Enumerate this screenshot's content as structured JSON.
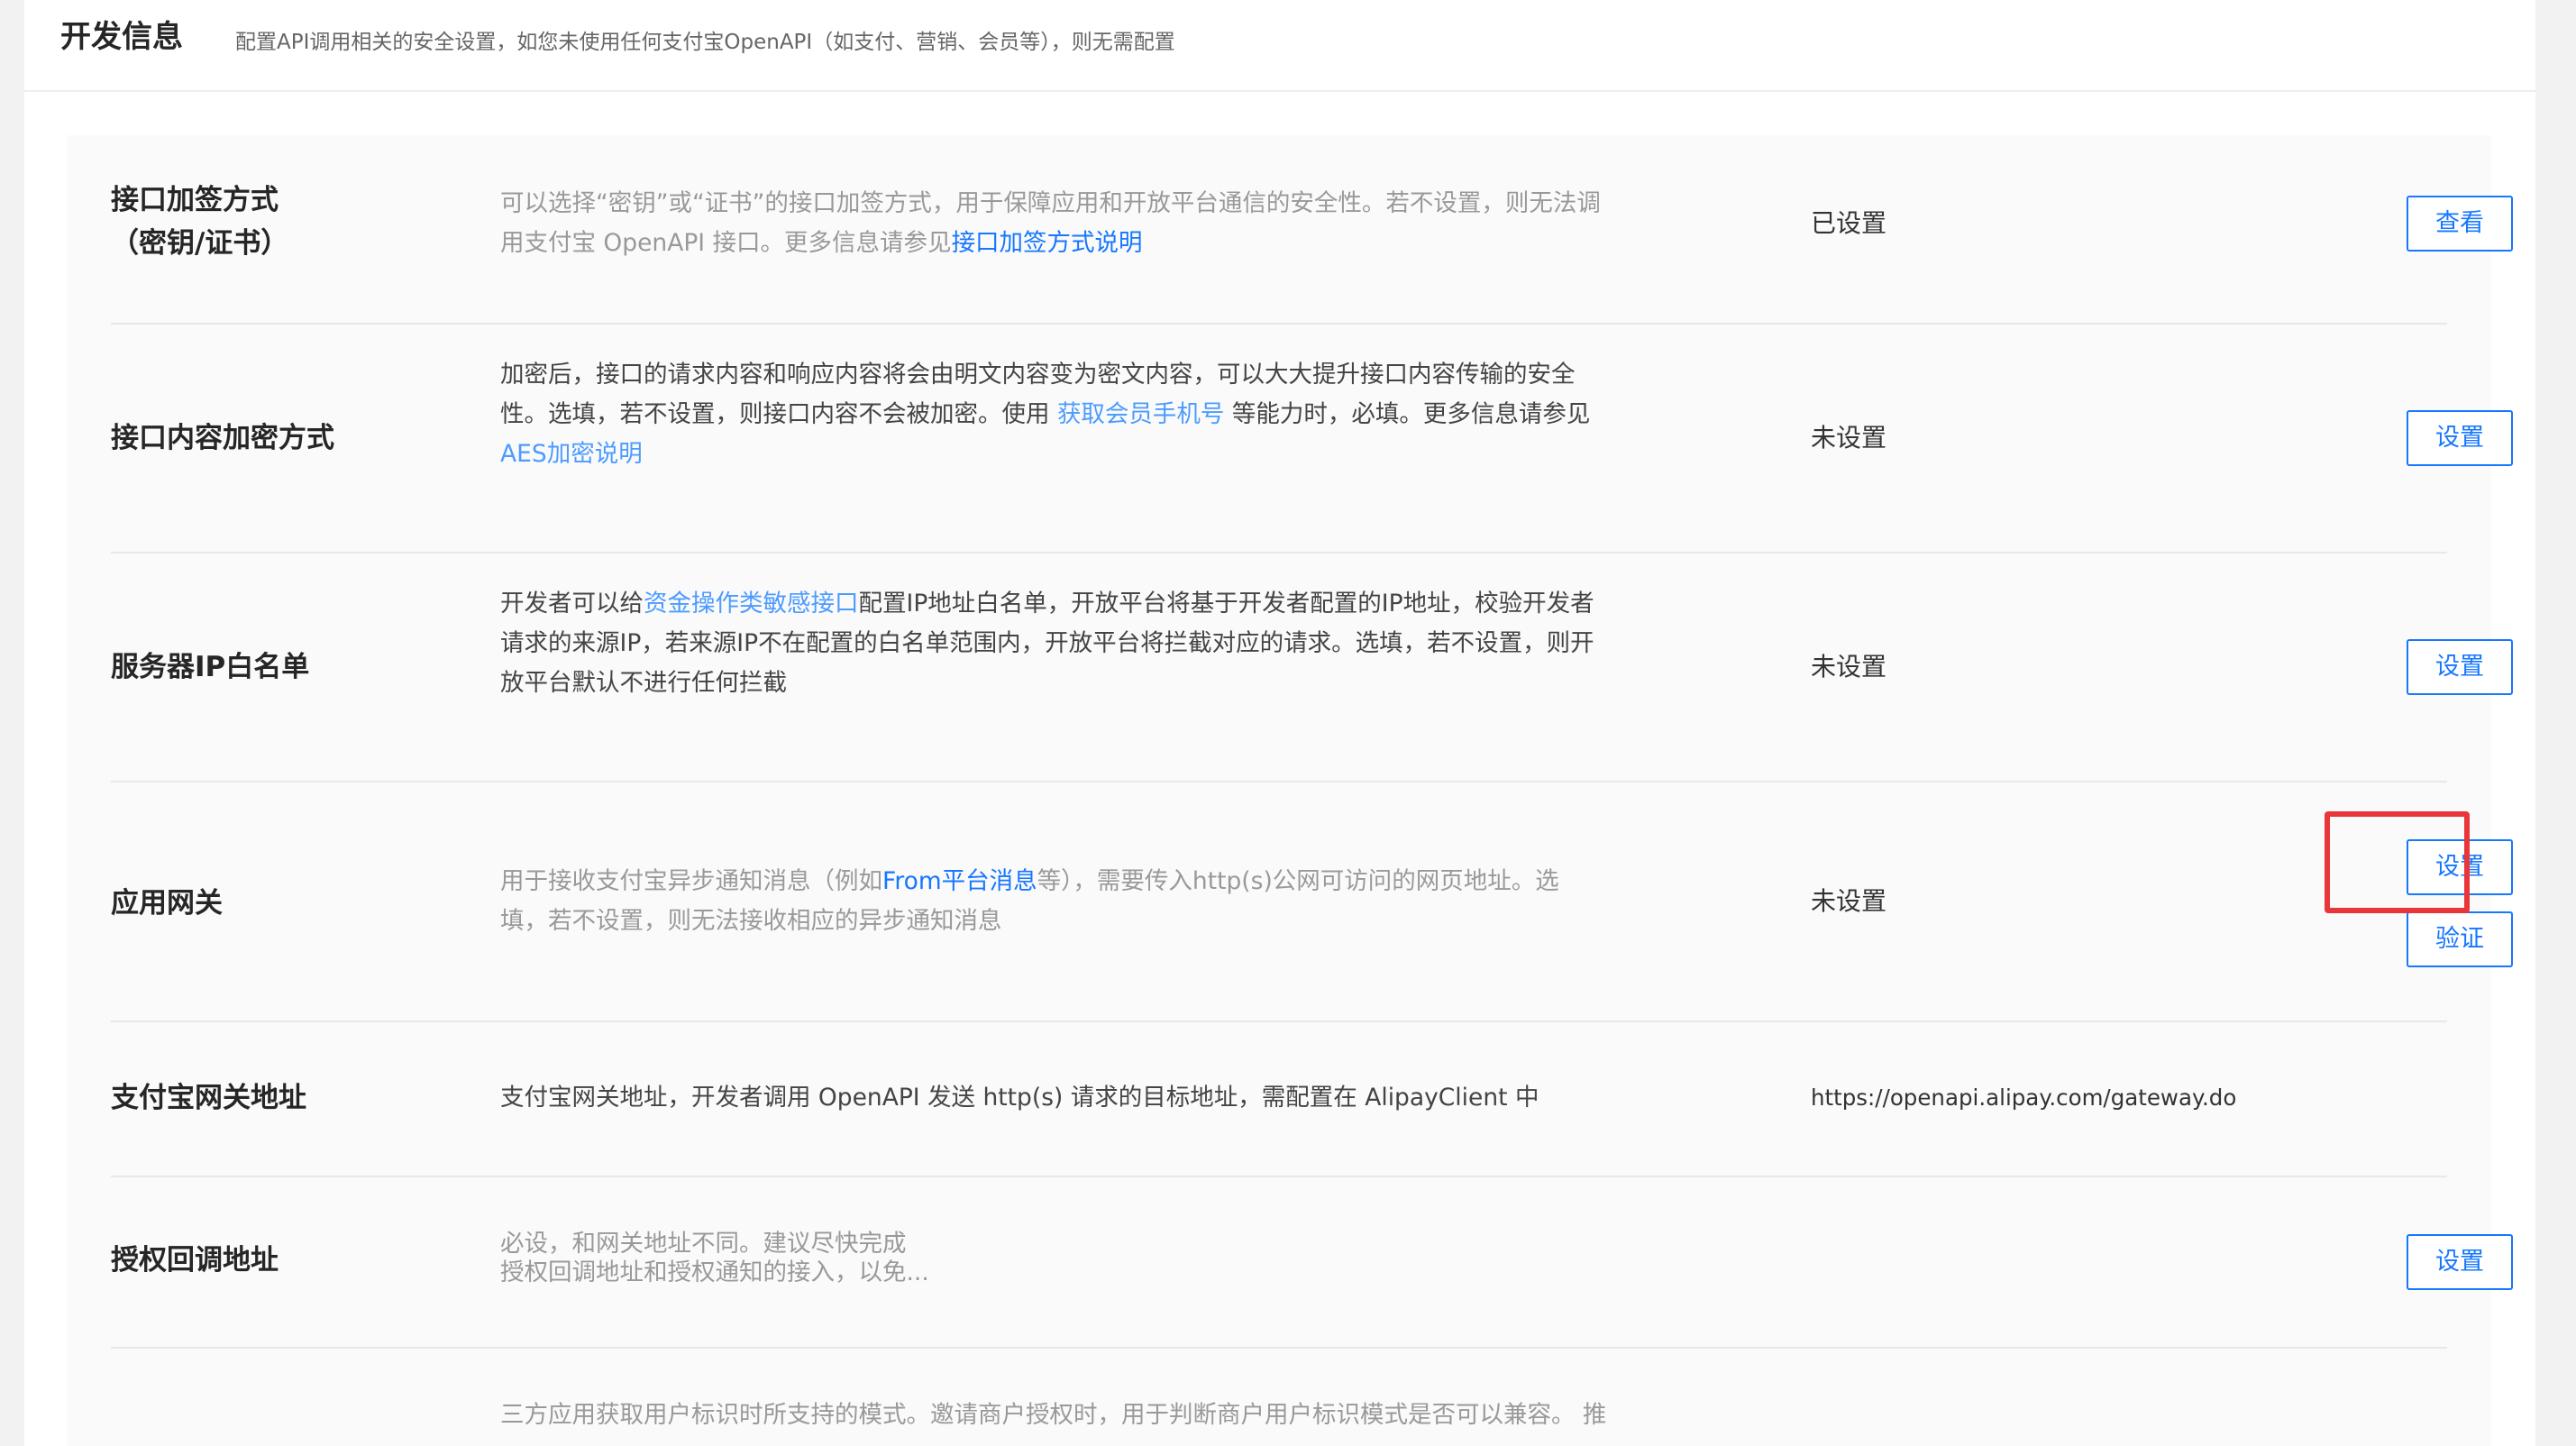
{
  "header": {
    "title": "开发信息",
    "description": "配置API调用相关的安全设置，如您未使用任何支付宝OpenAPI（如支付、营销、会员等），则无需配置"
  },
  "rows": [
    {
      "label_line1": "接口加签方式",
      "label_line2": "（密钥/证书）",
      "desc_line1": "可以选择“密钥”或“证书”的接口加签方式，用于保障应用和开放平台通信的安全性。若不设置，则无法调",
      "desc_line2_text": "用支付宝 OpenAPI 接口。更多信息请参见",
      "desc_link": "接口加签方式说明",
      "status": "已设置",
      "button": "查看"
    },
    {
      "label": "接口内容加密方式",
      "desc_line1": "加密后，接口的请求内容和响应内容将会由明文内容变为密文内容，可以大大提升接口内容传输的安全",
      "desc_line2_text": "性。选填，若不设置，则接口内容不会被加密。使用 ",
      "desc_link1": "获取会员手机号",
      "desc_line2_after": " 等能力时，必填。更多信息请参见",
      "desc_link2": "AES加密说明",
      "status": "未设置",
      "button": "设置"
    },
    {
      "label": "服务器IP白名单",
      "desc_line1_before": "开发者可以给",
      "desc_link": "资金操作类敏感接口",
      "desc_line1_after": "配置IP地址白名单，开放平台将基于开发者配置的IP地址，校验开发者",
      "desc_line2": "请求的来源IP，若来源IP不在配置的白名单范围内，开放平台将拦截对应的请求。选填，若不设置，则开",
      "desc_line3": "放平台默认不进行任何拦截",
      "status": "未设置",
      "button": "设置"
    },
    {
      "label": "应用网关",
      "desc_line1_before": "用于接收支付宝异步通知消息（例如",
      "desc_link": "From平台消息",
      "desc_line1_after": "等），需要传入http(s)公网可访问的网页地址。选",
      "desc_line2": "填，若不设置，则无法接收相应的异步通知消息",
      "status": "未设置",
      "button": "设置",
      "button2": "验证"
    },
    {
      "label": "支付宝网关地址",
      "desc": "支付宝网关地址，开发者调用 OpenAPI 发送 http(s) 请求的目标地址，需配置在 AlipayClient 中",
      "status": "https://openapi.alipay.com/gateway.do"
    },
    {
      "label": "授权回调地址",
      "desc_line1": "必设，和网关地址不同。建议尽快完成",
      "desc_line2": "授权回调地址和授权通知的接入，以免...",
      "button": "设置"
    },
    {
      "desc_line1": "三方应用获取用户标识时所支持的模式。邀请商户授权时，用于判断商户用户标识模式是否可以兼容。 推"
    }
  ]
}
